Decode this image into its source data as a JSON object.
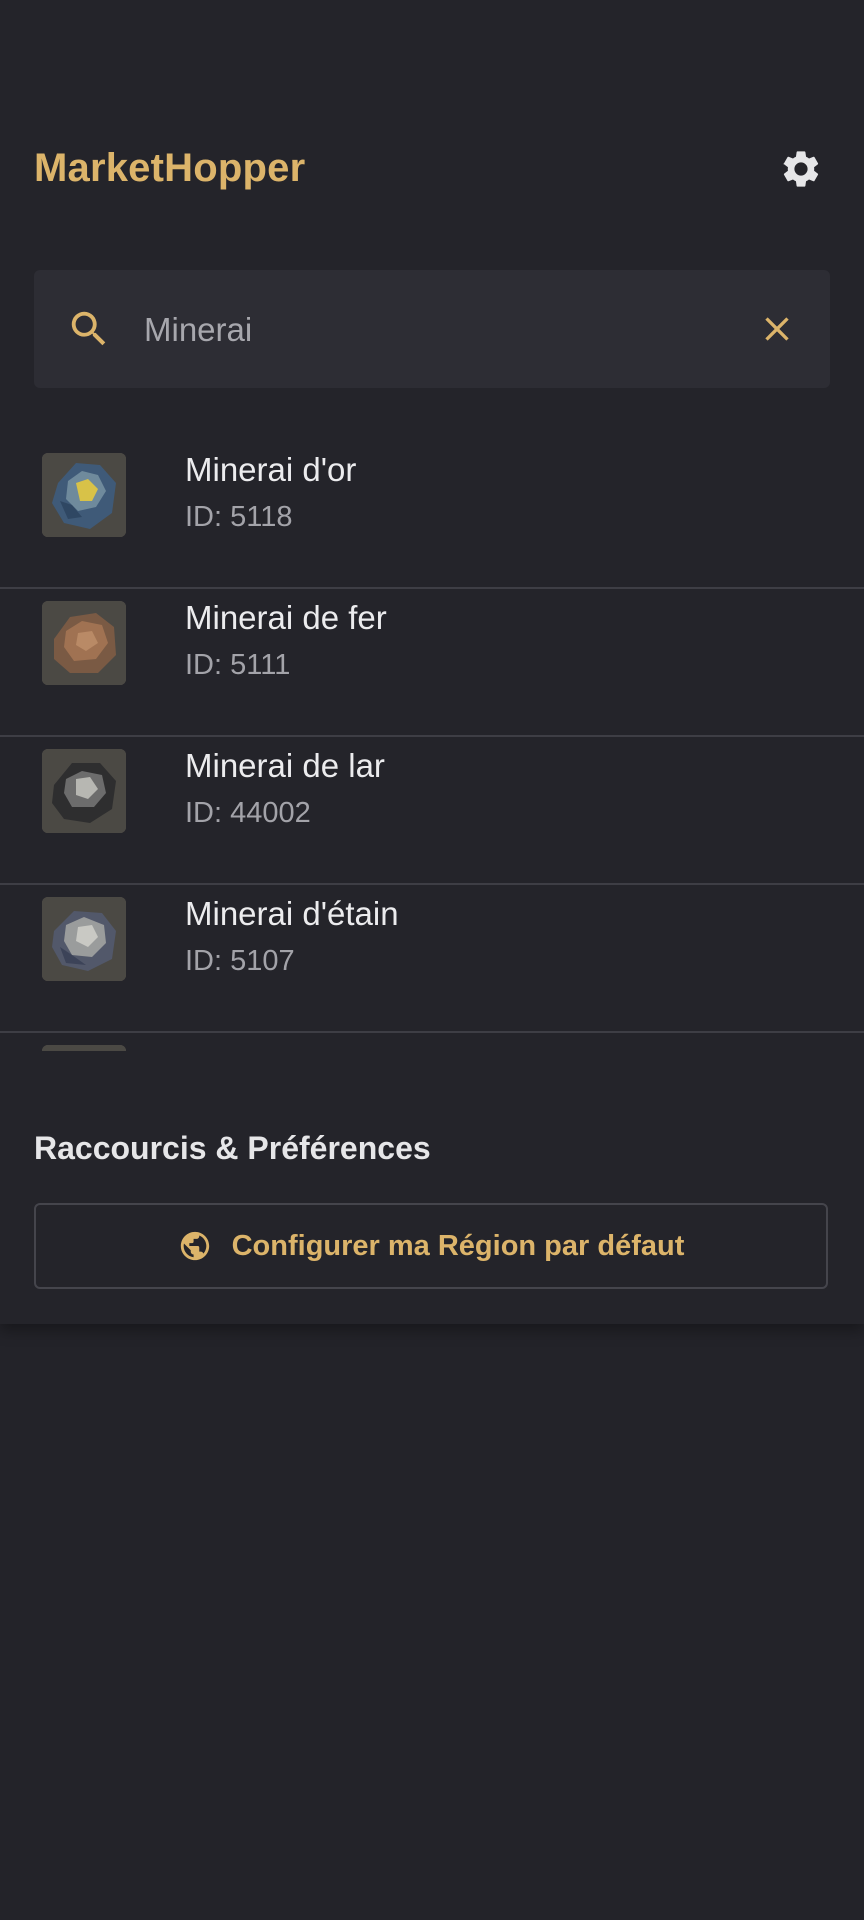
{
  "header": {
    "title": "MarketHopper",
    "settings_icon": "gear-icon"
  },
  "search": {
    "value": "Minerai",
    "search_icon": "search-icon",
    "clear_icon": "close-icon"
  },
  "results": [
    {
      "name": "Minerai d'or",
      "id_label": "ID: 5118",
      "thumb": "gold-ore"
    },
    {
      "name": "Minerai de fer",
      "id_label": "ID: 5111",
      "thumb": "iron-ore"
    },
    {
      "name": "Minerai de lar",
      "id_label": "ID: 44002",
      "thumb": "lar-ore"
    },
    {
      "name": "Minerai d'étain",
      "id_label": "ID: 5107",
      "thumb": "tin-ore"
    }
  ],
  "preferences": {
    "title": "Raccourcis & Préférences",
    "region_button_label": "Configurer ma Région par défaut",
    "region_icon": "globe-icon"
  },
  "colors": {
    "accent": "#dcb46a",
    "background": "#232329",
    "surface": "#2d2d34"
  }
}
